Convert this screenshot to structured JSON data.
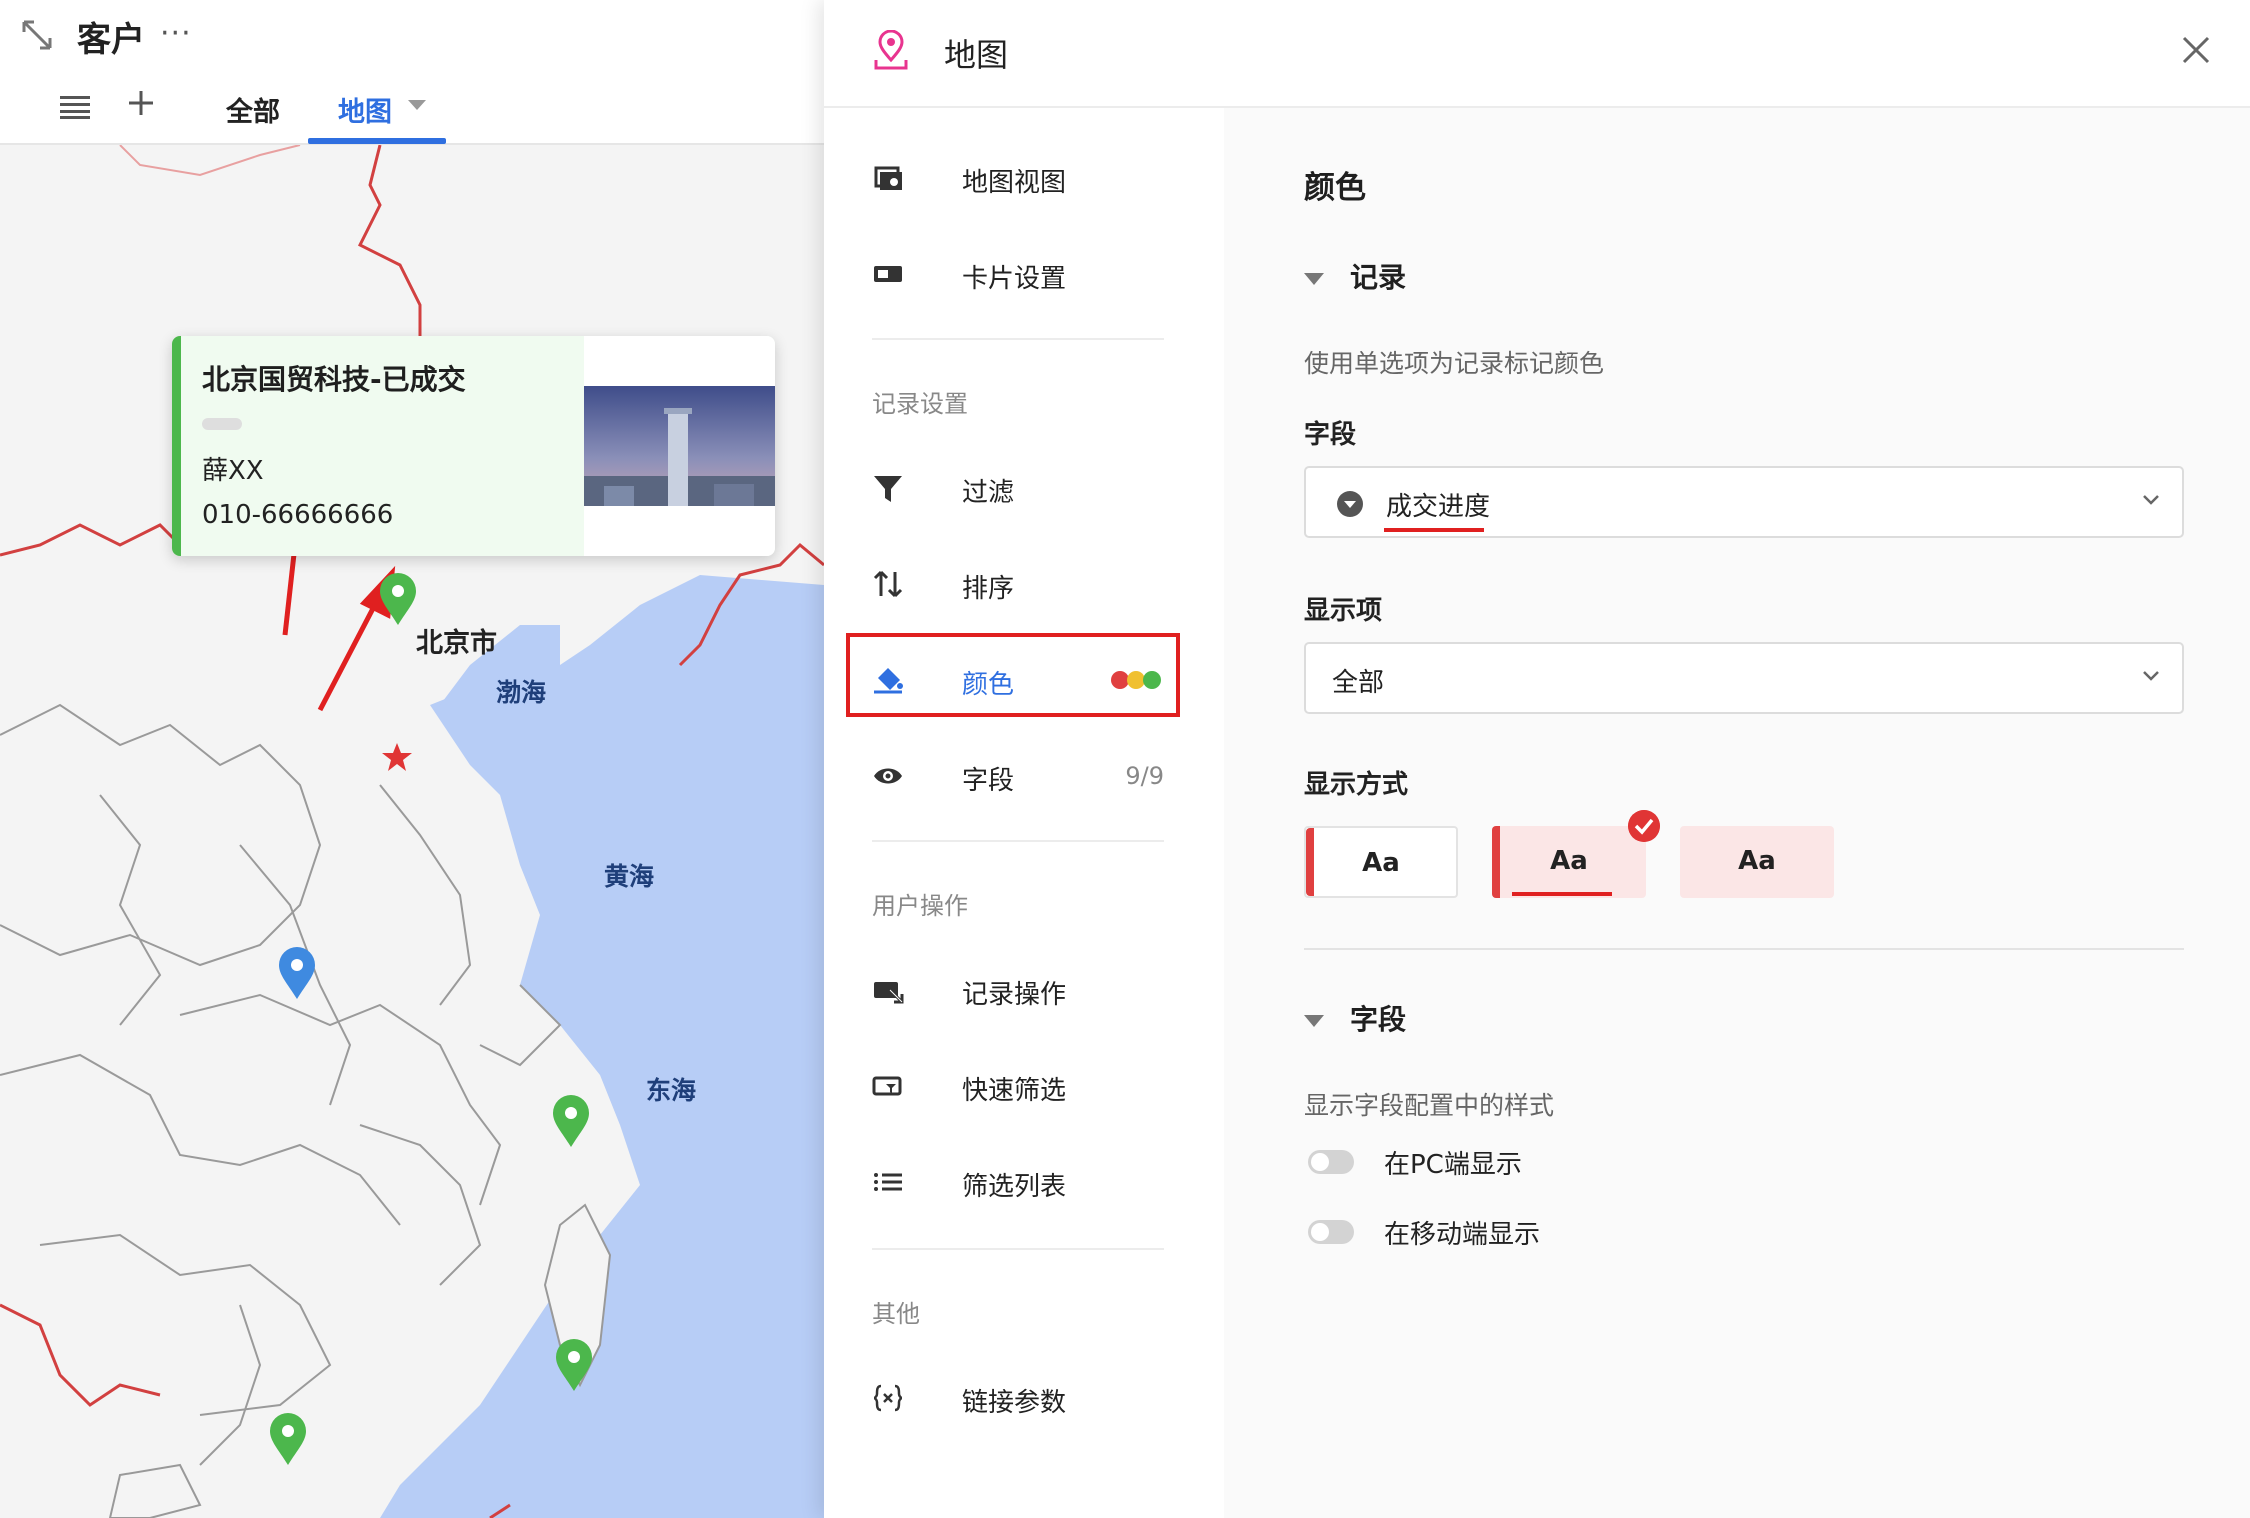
{
  "header": {
    "title": "客户",
    "more": "···",
    "tabs": [
      {
        "label": "全部"
      },
      {
        "label": "地图"
      }
    ]
  },
  "map": {
    "labels": {
      "bohai": "渤海",
      "huanghai": "黄海",
      "donghai": "东海",
      "beijing": "北京市"
    },
    "popup": {
      "title": "北京国贸科技-已成交",
      "name": "薛XX",
      "phone": "010-66666666"
    },
    "colors": {
      "sea": "#b7cdf6",
      "land": "#f4f4f4",
      "pin_green": "#4cb74c",
      "pin_blue": "#3f8ae0",
      "accent_red": "#e02020"
    }
  },
  "panel": {
    "title": "地图",
    "side": {
      "items_top": [
        {
          "label": "地图视图",
          "icon": "map-view-icon"
        },
        {
          "label": "卡片设置",
          "icon": "card-icon"
        }
      ],
      "group_record": "记录设置",
      "items_record": [
        {
          "label": "过滤",
          "icon": "filter-icon"
        },
        {
          "label": "排序",
          "icon": "sort-icon"
        },
        {
          "label": "颜色",
          "icon": "paint-bucket-icon"
        },
        {
          "label": "字段",
          "icon": "eye-icon",
          "count": "9/9"
        }
      ],
      "group_user": "用户操作",
      "items_user": [
        {
          "label": "记录操作",
          "icon": "record-action-icon"
        },
        {
          "label": "快速筛选",
          "icon": "quick-filter-icon"
        },
        {
          "label": "筛选列表",
          "icon": "list-icon"
        }
      ],
      "group_other": "其他",
      "items_other": [
        {
          "label": "链接参数",
          "icon": "braces-icon"
        }
      ]
    },
    "content": {
      "title": "颜色",
      "record_section": "记录",
      "record_desc": "使用单选项为记录标记颜色",
      "field_label": "字段",
      "field_value": "成交进度",
      "display_label": "显示项",
      "display_value": "全部",
      "mode_label": "显示方式",
      "mode_options": [
        "Aa",
        "Aa",
        "Aa"
      ],
      "mode_selected": 2,
      "field_section": "字段",
      "field_desc": "显示字段配置中的样式",
      "toggles": [
        {
          "label": "在PC端显示",
          "on": false
        },
        {
          "label": "在移动端显示",
          "on": false
        }
      ]
    }
  }
}
